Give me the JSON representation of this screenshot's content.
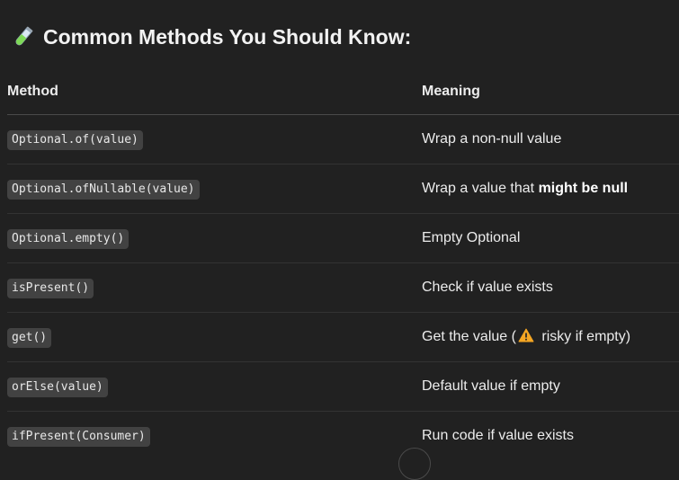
{
  "heading": {
    "icon": "test-tube-icon",
    "text": "Common Methods You Should Know:"
  },
  "table": {
    "headers": {
      "method": "Method",
      "meaning": "Meaning"
    },
    "rows": [
      {
        "method": "Optional.of(value)",
        "meaning_pre": "Wrap a non-null value",
        "meaning_bold": "",
        "meaning_post": ""
      },
      {
        "method": "Optional.ofNullable(value)",
        "meaning_pre": "Wrap a value that ",
        "meaning_bold": "might be null",
        "meaning_post": ""
      },
      {
        "method": "Optional.empty()",
        "meaning_pre": "Empty Optional",
        "meaning_bold": "",
        "meaning_post": ""
      },
      {
        "method": "isPresent()",
        "meaning_pre": "Check if value exists",
        "meaning_bold": "",
        "meaning_post": ""
      },
      {
        "method": "get()",
        "meaning_pre": "Get the value (",
        "meaning_icon": "warning-icon",
        "meaning_post": " risky if empty)"
      },
      {
        "method": "orElse(value)",
        "meaning_pre": "Default value if empty",
        "meaning_bold": "",
        "meaning_post": ""
      },
      {
        "method": "ifPresent(Consumer)",
        "meaning_pre": "Run code if value exists",
        "meaning_bold": "",
        "meaning_post": ""
      }
    ]
  },
  "colors": {
    "background": "#212121",
    "code_background": "#424242",
    "warning": "#f5a623"
  }
}
